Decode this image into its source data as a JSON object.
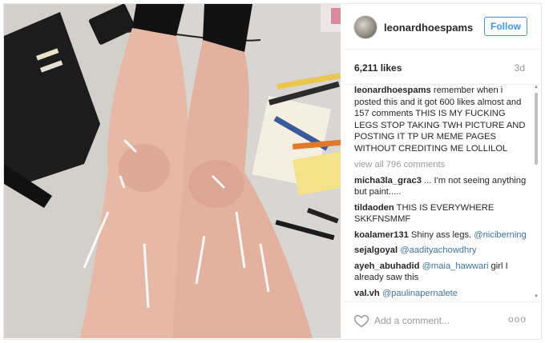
{
  "post": {
    "username": "leonardhoespams",
    "follow_label": "Follow",
    "likes": "6,211 likes",
    "age": "3d",
    "caption": "remember when i posted this and it got 600 likes almost and 157 comments THIS IS MY FUCKING LEGS STOP TAKING TWH PICTURE AND POSTING IT TP UR MEME PAGES WITHOUT CREDITING ME LOLLILOL",
    "view_all": "view all 796 comments",
    "comments": [
      {
        "user": "micha3la_grac3",
        "text": "... I'm not seeing anything but paint....."
      },
      {
        "user": "tildaoden",
        "text": "THIS IS EVERYWHERE SKKFNSMMF"
      },
      {
        "user": "koalamer131",
        "text": "Shiny ass legs. ",
        "mention": "@niciberning"
      },
      {
        "user": "sejalgoyal",
        "text": "",
        "mention": "@aadityachowdhry"
      },
      {
        "user": "ayeh_abuhadid",
        "text": " girl I already saw this",
        "mention": "@maia_hawwari",
        "mention_first": true
      },
      {
        "user": "val.vh",
        "text": "",
        "mention": "@paulinapernalete"
      }
    ],
    "add_comment_placeholder": "Add a comment...",
    "more_label": "ooo"
  },
  "icons": {
    "heart": "heart-icon",
    "avatar": "avatar",
    "more": "more-options-icon"
  },
  "colors": {
    "accent": "#3897f0",
    "mention": "#3f729b"
  }
}
